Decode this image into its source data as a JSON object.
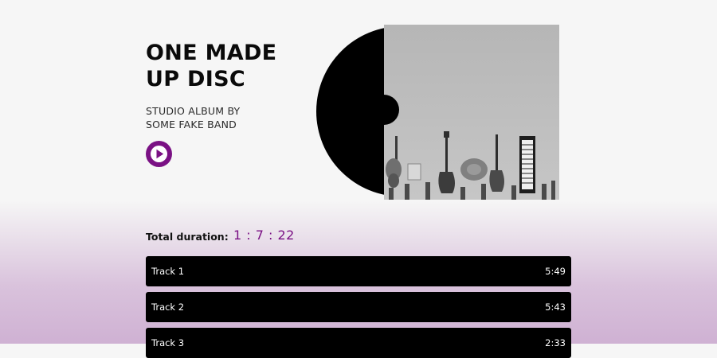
{
  "album": {
    "title_line1": "ONE MADE",
    "title_line2": "UP DISC",
    "subtitle_line1": "STUDIO ALBUM BY",
    "subtitle_line2": "SOME FAKE BAND"
  },
  "player": {
    "play_icon": "play-icon",
    "accent_color": "#7a1184"
  },
  "summary": {
    "duration_label": "Total duration:",
    "duration_value": "1 : 7 : 22"
  },
  "tracks": [
    {
      "name": "Track 1",
      "time": "5:49"
    },
    {
      "name": "Track 2",
      "time": "5:43"
    },
    {
      "name": "Track 3",
      "time": "2:33"
    }
  ]
}
